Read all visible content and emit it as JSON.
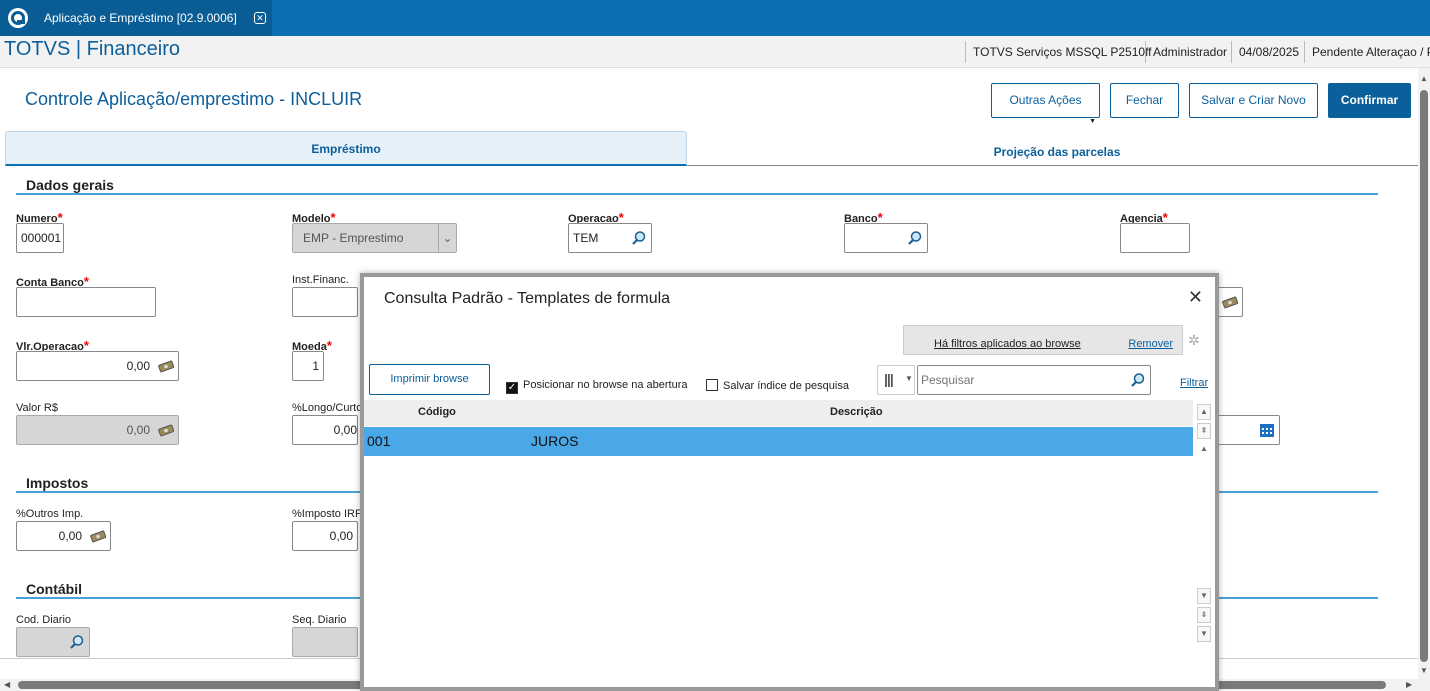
{
  "topbar": {
    "tab_title": "Aplicação e Empréstimo [02.9.0006]"
  },
  "header": {
    "brand": "TOTVS | Financeiro",
    "environment": "TOTVS Serviços MSSQL P2510ff",
    "user": "Administrador",
    "date": "04/08/2025",
    "status": "Pendente Alteraçao / Pe"
  },
  "page": {
    "title": "Controle Aplicação/emprestimo - INCLUIR",
    "buttons": {
      "outras_acoes": "Outras Ações",
      "fechar": "Fechar",
      "salvar_criar": "Salvar e Criar Novo",
      "confirmar": "Confirmar"
    },
    "tabs": [
      "Empréstimo",
      "Projeção das parcelas"
    ]
  },
  "sections": {
    "dados_gerais": "Dados gerais",
    "impostos": "Impostos",
    "contabil": "Contábil"
  },
  "fields": {
    "numero": {
      "label": "Numero",
      "value": "000001"
    },
    "modelo": {
      "label": "Modelo",
      "value": "EMP - Emprestimo"
    },
    "operacao": {
      "label": "Operacao",
      "value": "TEM"
    },
    "banco": {
      "label": "Banco",
      "value": ""
    },
    "agencia": {
      "label": "Agencia",
      "value": ""
    },
    "conta_banco": {
      "label": "Conta Banco",
      "value": ""
    },
    "inst_financ": {
      "label": "Inst.Financ.",
      "value": ""
    },
    "vlr_operacao": {
      "label": "Vlr.Operacao",
      "value": "0,00"
    },
    "moeda": {
      "label": "Moeda",
      "value": "1"
    },
    "valor_rs": {
      "label": "Valor R$",
      "value": "0,00"
    },
    "longo_curto": {
      "label": "%Longo/Curto",
      "value": "0,00"
    },
    "outros_imp": {
      "label": "%Outros Imp.",
      "value": "0,00"
    },
    "imposto_irf": {
      "label": "%Imposto IRF",
      "value": "0,00"
    },
    "cod_diario": {
      "label": "Cod. Diario",
      "value": ""
    },
    "seq_diario": {
      "label": "Seq. Diario",
      "value": ""
    }
  },
  "modal": {
    "title": "Consulta Padrão - Templates de formula",
    "filter_notice": "Há filtros aplicados ao browse",
    "remove": "Remover",
    "print_button": "Imprimir browse",
    "check_position": "Posicionar no browse na abertura",
    "check_position_checked": true,
    "check_index": "Salvar índice de pesquisa",
    "check_index_checked": false,
    "search_placeholder": "Pesquisar",
    "filter_link": "Filtrar",
    "columns": [
      "Código",
      "Descrição"
    ],
    "rows": [
      {
        "codigo": "001",
        "descricao": "JUROS"
      }
    ]
  },
  "colors": {
    "primary": "#0b6fb3",
    "selected_row": "#4aa8e6",
    "required": "#ee0000"
  }
}
